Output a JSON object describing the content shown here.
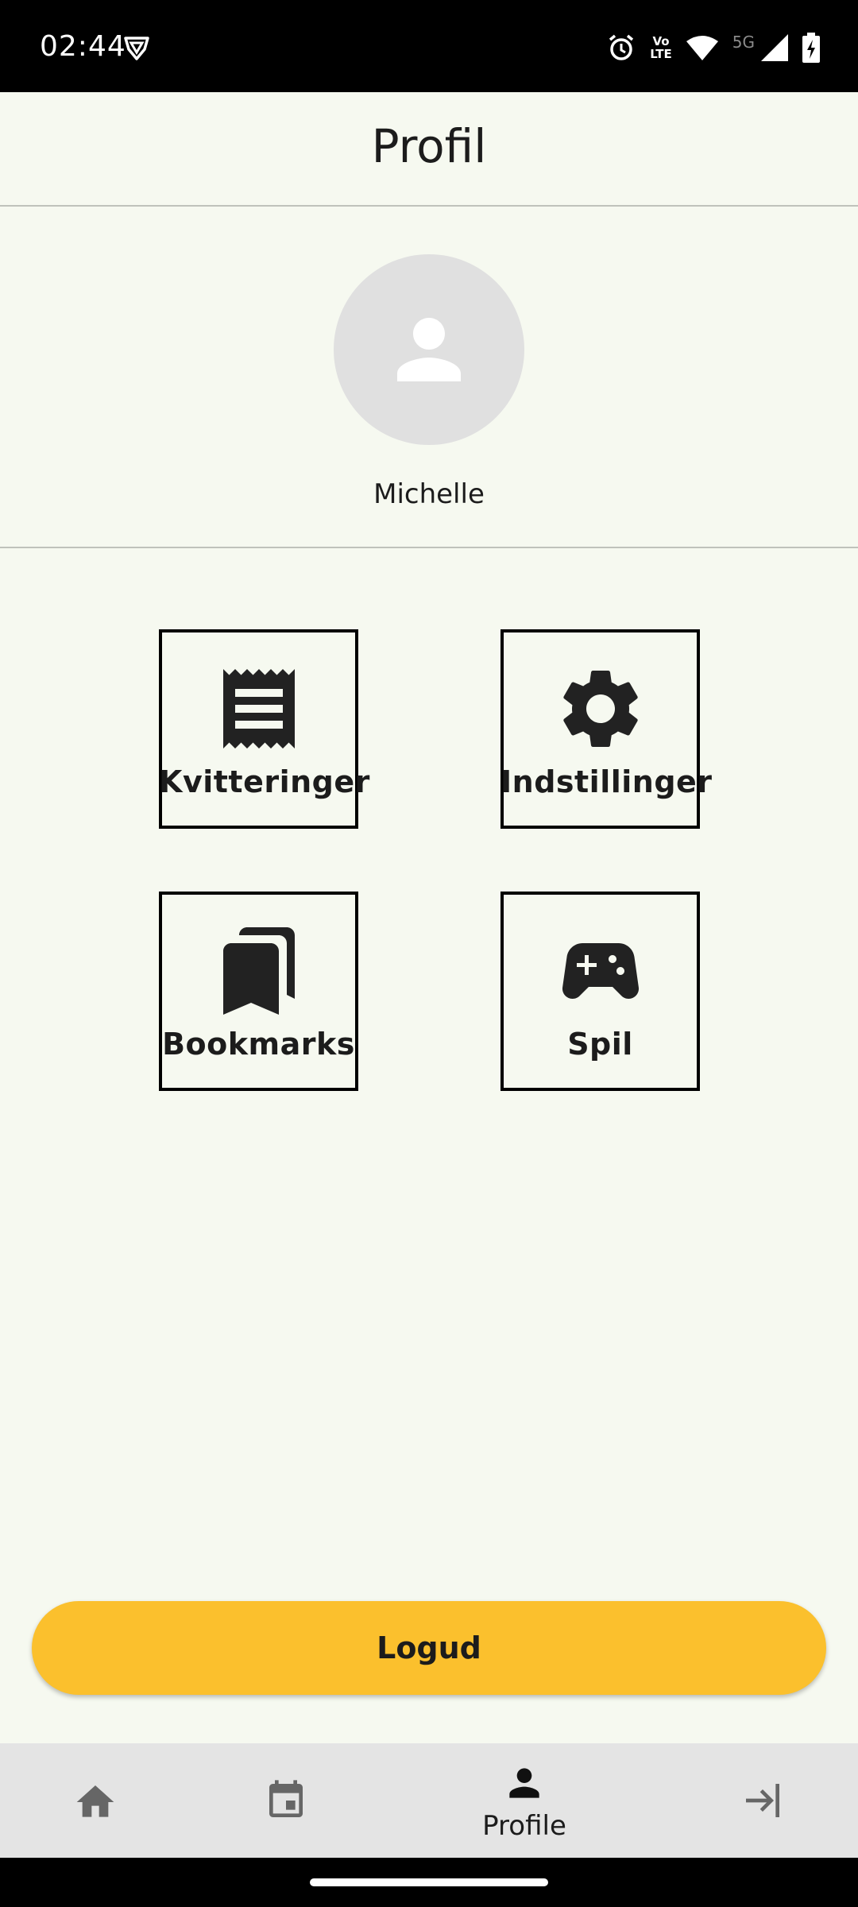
{
  "status_bar": {
    "time": "02:44",
    "network_label": "5G",
    "volte_top": "Vo",
    "volte_bottom": "LTE",
    "icons": [
      "vpn-icon",
      "alarm-icon",
      "volte-icon",
      "wifi-icon",
      "signal-icon",
      "battery-charging-icon"
    ]
  },
  "header": {
    "title": "Profil"
  },
  "profile": {
    "avatar_icon": "person-icon",
    "name": "Michelle"
  },
  "tiles": [
    {
      "label": "Kvitteringer",
      "icon": "receipt-icon"
    },
    {
      "label": "Indstillinger",
      "icon": "gear-icon"
    },
    {
      "label": "Bookmarks",
      "icon": "bookmarks-icon"
    },
    {
      "label": "Spil",
      "icon": "gamepad-icon"
    }
  ],
  "logout": {
    "label": "Logud"
  },
  "bottom_nav": {
    "items": [
      {
        "icon": "home-icon",
        "label": ""
      },
      {
        "icon": "calendar-icon",
        "label": ""
      },
      {
        "icon": "person-icon",
        "label": "Profile",
        "active": true
      },
      {
        "icon": "login-icon",
        "label": ""
      }
    ]
  },
  "colors": {
    "background": "#f6f9f0",
    "accent": "#fbc02d",
    "nav_background": "#e4e4e4",
    "inactive_icon": "#666666",
    "text": "#1c1c1c"
  }
}
